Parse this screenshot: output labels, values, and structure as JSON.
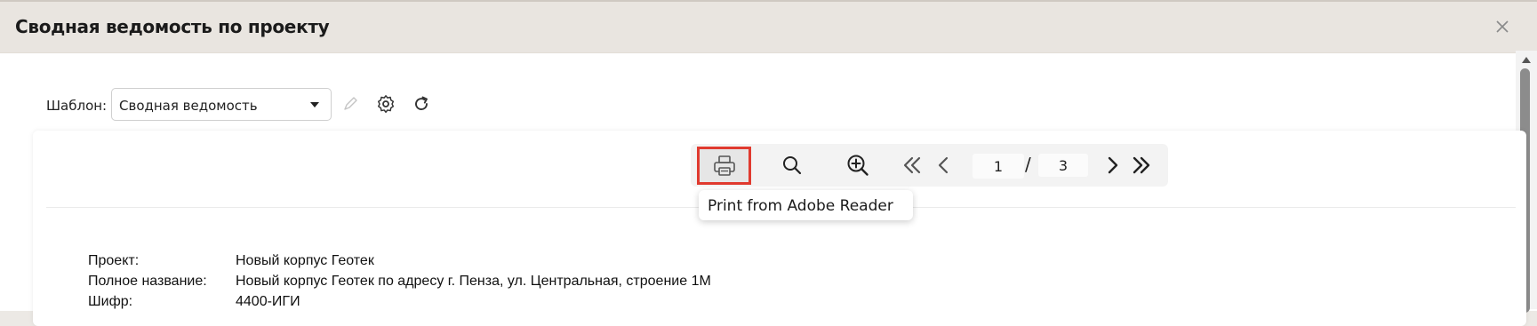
{
  "dialog": {
    "title": "Сводная ведомость по проекту"
  },
  "toolbar": {
    "template_label": "Шаблон:",
    "template_value": "Сводная ведомость",
    "icons": [
      "pencil-icon",
      "gear-icon",
      "refresh-icon"
    ]
  },
  "viewer": {
    "current_page": "1",
    "page_separator": "/",
    "total_pages": "3",
    "print_tooltip": "Print from Adobe Reader",
    "icons": [
      "printer-icon",
      "search-icon",
      "zoom-in-icon",
      "first-page-icon",
      "prev-page-icon",
      "next-page-icon",
      "last-page-icon"
    ],
    "print_highlight_color": "#e03a2f"
  },
  "document": {
    "fields": [
      {
        "label": "Проект:",
        "value": "Новый корпус Геотек"
      },
      {
        "label": "Полное название:",
        "value": "Новый корпус Геотек по адресу г. Пенза, ул. Центральная, строение 1М"
      },
      {
        "label": "Шифр:",
        "value": "4400-ИГИ"
      }
    ]
  }
}
